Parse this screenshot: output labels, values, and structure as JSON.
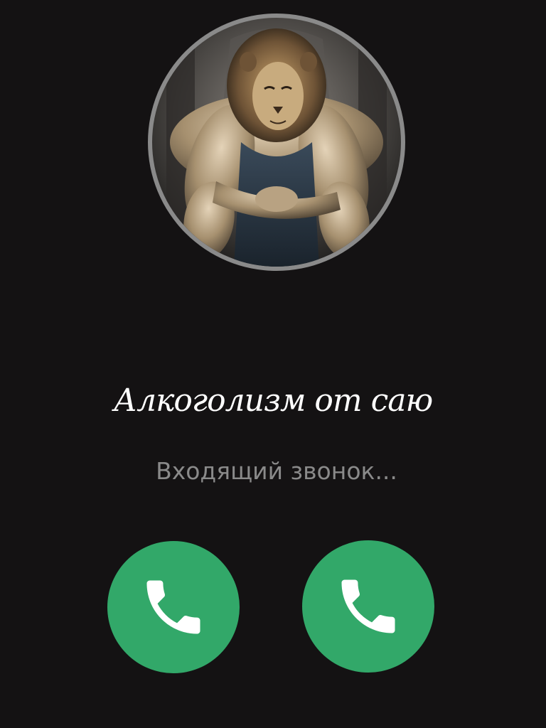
{
  "caller": {
    "name": "Алкоголизм от саю",
    "status": "Входящий звонок...",
    "avatar_icon": "lion-bodybuilder-avatar"
  },
  "buttons": {
    "left_icon": "phone-icon",
    "right_icon": "phone-icon"
  },
  "colors": {
    "background": "#141213",
    "button": "#32a869",
    "avatar_ring": "#8a8a8a",
    "status_text": "#8a8a8a",
    "name_text": "#ffffff"
  }
}
